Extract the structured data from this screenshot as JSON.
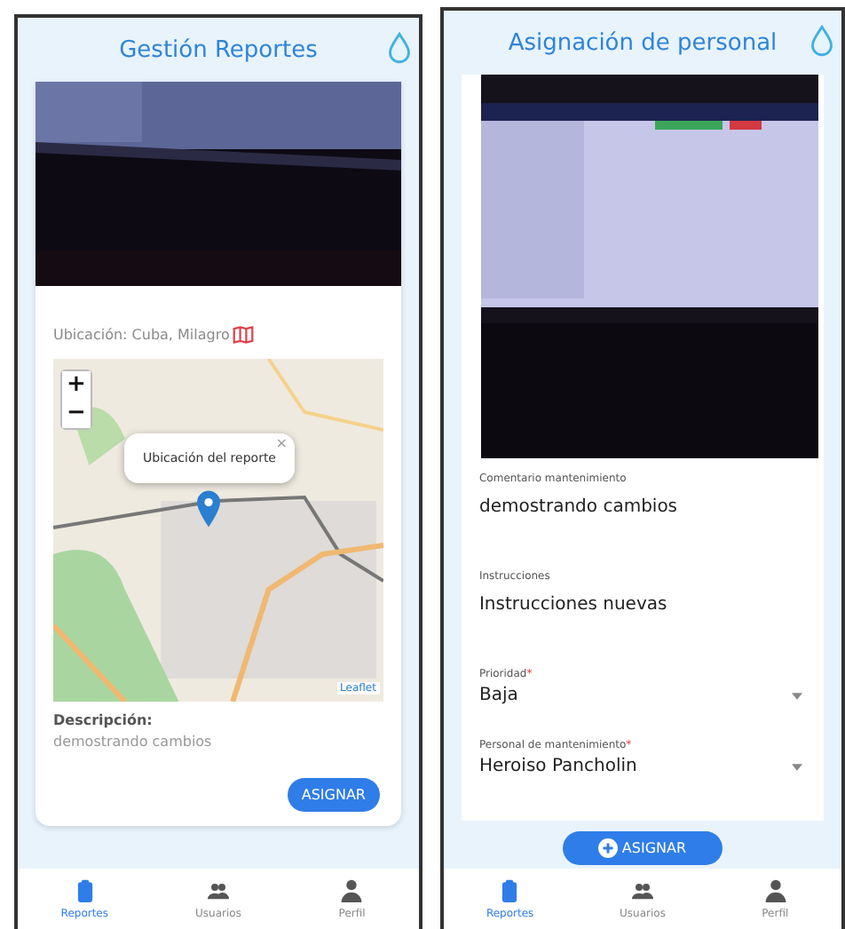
{
  "screens": [
    {
      "kind": "report",
      "title": "Gestión Reportes",
      "location_label": "Ubicación: Cuba, Milagro",
      "map": {
        "zoom_in": "+",
        "zoom_out": "−",
        "popup": "Ubicación del reporte",
        "popup_close": "×",
        "attribution": "Leaflet"
      },
      "description_label": "Descripción:",
      "description": "demostrando cambios",
      "button": "ASIGNAR",
      "nav": [
        {
          "label": "Reportes",
          "selected": true
        },
        {
          "label": "Usuarios",
          "selected": false
        },
        {
          "label": "Perfil",
          "selected": false
        }
      ]
    },
    {
      "kind": "assign",
      "title": "Asignación de personal",
      "fields": [
        {
          "kind": "text",
          "label": "Comentario mantenimiento",
          "value": "demostrando cambios"
        },
        {
          "kind": "text",
          "label": "Instrucciones",
          "value": "Instrucciones nuevas"
        },
        {
          "kind": "select",
          "label": "Prioridad",
          "required_mark": "*",
          "value": "Baja"
        },
        {
          "kind": "select",
          "label": "Personal de mantenimiento",
          "required_mark": "*",
          "value": "Heroiso Pancholin"
        }
      ],
      "button": "ASIGNAR",
      "nav": [
        {
          "label": "Reportes",
          "selected": true
        },
        {
          "label": "Usuarios",
          "selected": false
        },
        {
          "label": "Perfil",
          "selected": false
        }
      ]
    }
  ]
}
